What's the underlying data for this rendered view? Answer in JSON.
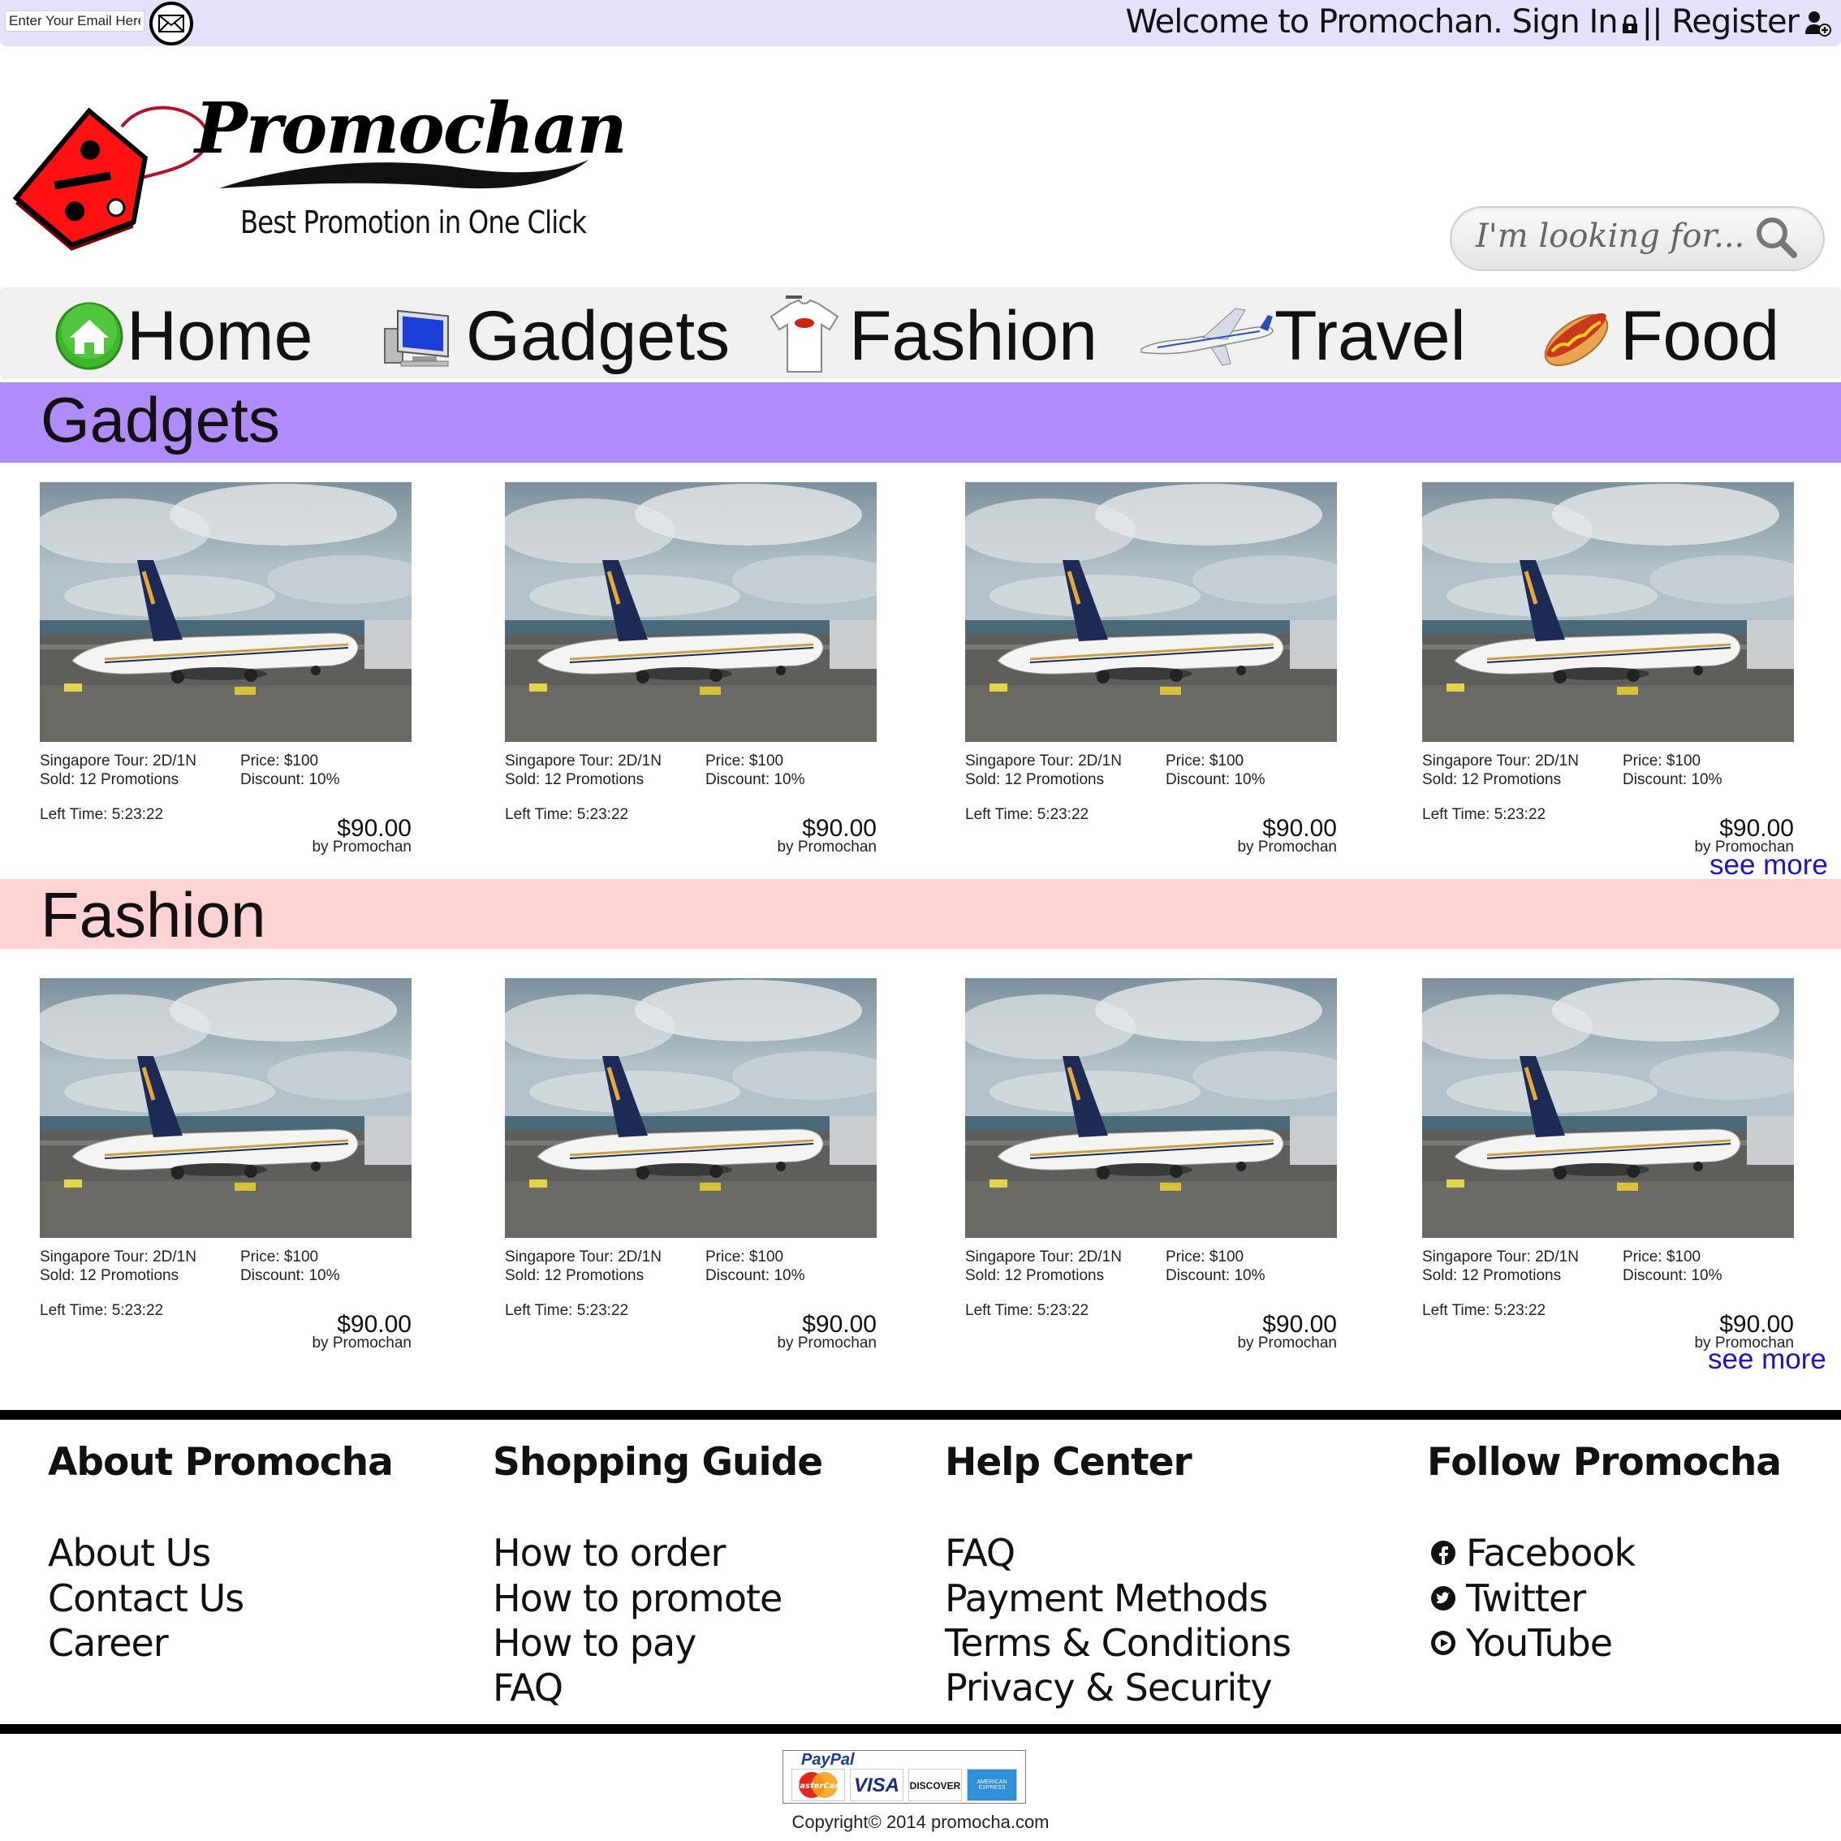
{
  "topbar": {
    "email_placeholder": "Enter Your Email Here",
    "welcome": "Welcome to Promochan.",
    "sign_in": "Sign In",
    "separator": "||",
    "register": "Register"
  },
  "logo": {
    "name": "Promochan",
    "tagline": "Best Promotion in One Click"
  },
  "search": {
    "placeholder": "I'm looking for..."
  },
  "nav": [
    {
      "label": "Home",
      "icon": "home-icon"
    },
    {
      "label": "Gadgets",
      "icon": "computer-icon"
    },
    {
      "label": "Fashion",
      "icon": "tshirt-icon"
    },
    {
      "label": "Travel",
      "icon": "airplane-icon"
    },
    {
      "label": "Food",
      "icon": "hotdog-icon"
    }
  ],
  "sections": [
    {
      "title": "Gadgets",
      "color": "#b08bfa",
      "see_more": "see more",
      "products": [
        {
          "name": "Singapore Tour: 2D/1N",
          "price": "Price: $100",
          "sold": "Sold: 12 Promotions",
          "discount": "Discount: 10%",
          "left_time": "Left Time: 5:23:22",
          "final_price": "$90.00",
          "by": "by Promochan"
        },
        {
          "name": "Singapore Tour: 2D/1N",
          "price": "Price: $100",
          "sold": "Sold: 12 Promotions",
          "discount": "Discount: 10%",
          "left_time": "Left Time: 5:23:22",
          "final_price": "$90.00",
          "by": "by Promochan"
        },
        {
          "name": "Singapore Tour: 2D/1N",
          "price": "Price: $100",
          "sold": "Sold: 12 Promotions",
          "discount": "Discount: 10%",
          "left_time": "Left Time: 5:23:22",
          "final_price": "$90.00",
          "by": "by Promochan"
        },
        {
          "name": "Singapore Tour: 2D/1N",
          "price": "Price: $100",
          "sold": "Sold: 12 Promotions",
          "discount": "Discount: 10%",
          "left_time": "Left Time: 5:23:22",
          "final_price": "$90.00",
          "by": "by Promochan"
        }
      ]
    },
    {
      "title": "Fashion",
      "color": "#ffd3d3",
      "see_more": "see more",
      "products": [
        {
          "name": "Singapore Tour: 2D/1N",
          "price": "Price: $100",
          "sold": "Sold: 12 Promotions",
          "discount": "Discount: 10%",
          "left_time": "Left Time: 5:23:22",
          "final_price": "$90.00",
          "by": "by Promochan"
        },
        {
          "name": "Singapore Tour: 2D/1N",
          "price": "Price: $100",
          "sold": "Sold: 12 Promotions",
          "discount": "Discount: 10%",
          "left_time": "Left Time: 5:23:22",
          "final_price": "$90.00",
          "by": "by Promochan"
        },
        {
          "name": "Singapore Tour: 2D/1N",
          "price": "Price: $100",
          "sold": "Sold: 12 Promotions",
          "discount": "Discount: 10%",
          "left_time": "Left Time: 5:23:22",
          "final_price": "$90.00",
          "by": "by Promochan"
        },
        {
          "name": "Singapore Tour: 2D/1N",
          "price": "Price: $100",
          "sold": "Sold: 12 Promotions",
          "discount": "Discount: 10%",
          "left_time": "Left Time: 5:23:22",
          "final_price": "$90.00",
          "by": "by Promochan"
        }
      ]
    }
  ],
  "footer": {
    "columns": [
      {
        "heading": "About Promocha",
        "links": [
          "About Us",
          "Contact Us",
          "Career"
        ]
      },
      {
        "heading": "Shopping Guide",
        "links": [
          "How to order",
          "How to promote",
          "How to pay",
          "FAQ"
        ]
      },
      {
        "heading": "Help Center",
        "links": [
          "FAQ",
          "Payment Methods",
          "Terms & Conditions",
          "Privacy & Security"
        ]
      },
      {
        "heading": "Follow Promocha",
        "links": [
          "Facebook",
          "Twitter",
          "YouTube"
        ],
        "icons": [
          "facebook-icon",
          "twitter-icon",
          "youtube-icon"
        ]
      }
    ],
    "payment": {
      "brand": "PayPal",
      "cards": [
        "MasterCard",
        "VISA",
        "DISCOVER",
        "AMERICAN EXPRESS"
      ]
    },
    "copyright": "Copyright© 2014 promocha.com"
  }
}
